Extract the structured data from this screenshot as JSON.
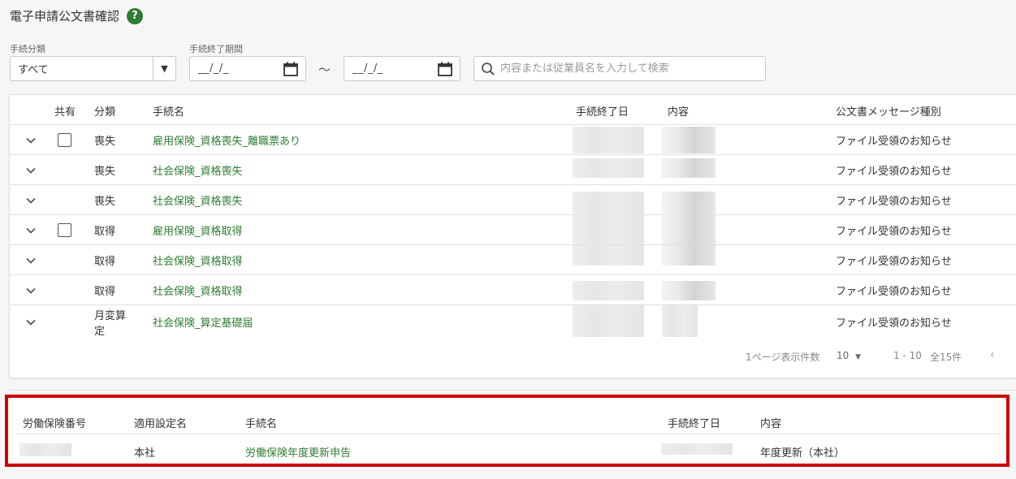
{
  "header": {
    "title": "電子申請公文書確認",
    "help": "?"
  },
  "filters": {
    "category_label": "手続分類",
    "category_value": "すべて",
    "period_label": "手続終了期間",
    "date_from_placeholder": "__/_/_",
    "date_to_placeholder": "__/_/_",
    "range_separator": "〜",
    "search_placeholder": "内容または従業員名を入力して検索"
  },
  "table": {
    "columns": [
      "共有",
      "分類",
      "手続名",
      "手続終了日",
      "内容",
      "公文書メッセージ種別"
    ],
    "rows": [
      {
        "shared_checkbox": true,
        "category": "喪失",
        "procedure": "雇用保険_資格喪失_離職票あり",
        "message_type": "ファイル受領のお知らせ"
      },
      {
        "shared_checkbox": false,
        "category": "喪失",
        "procedure": "社会保険_資格喪失",
        "message_type": "ファイル受領のお知らせ"
      },
      {
        "shared_checkbox": false,
        "category": "喪失",
        "procedure": "社会保険_資格喪失",
        "message_type": "ファイル受領のお知らせ"
      },
      {
        "shared_checkbox": true,
        "category": "取得",
        "procedure": "雇用保険_資格取得",
        "message_type": "ファイル受領のお知らせ"
      },
      {
        "shared_checkbox": false,
        "category": "取得",
        "procedure": "社会保険_資格取得",
        "message_type": "ファイル受領のお知らせ"
      },
      {
        "shared_checkbox": false,
        "category": "取得",
        "procedure": "社会保険_資格取得",
        "message_type": "ファイル受領のお知らせ"
      },
      {
        "shared_checkbox": false,
        "category_line1": "月変算",
        "category_line2": "定",
        "procedure": "社会保険_算定基礎届",
        "message_type": "ファイル受領のお知らせ"
      }
    ],
    "pagination": {
      "per_page_label": "1ページ表示件数",
      "per_page_value": "10",
      "range": "1 - 10",
      "total": "全15件"
    }
  },
  "labor_table": {
    "columns": [
      "労働保険番号",
      "適用設定名",
      "手続名",
      "手続終了日",
      "内容"
    ],
    "row": {
      "setting_name": "本社",
      "procedure": "労働保険年度更新申告",
      "content": "年度更新（本社）"
    }
  },
  "colors": {
    "link": "#2e7d32",
    "highlight_border": "#cc0000",
    "help_icon": "#2e7d32"
  }
}
